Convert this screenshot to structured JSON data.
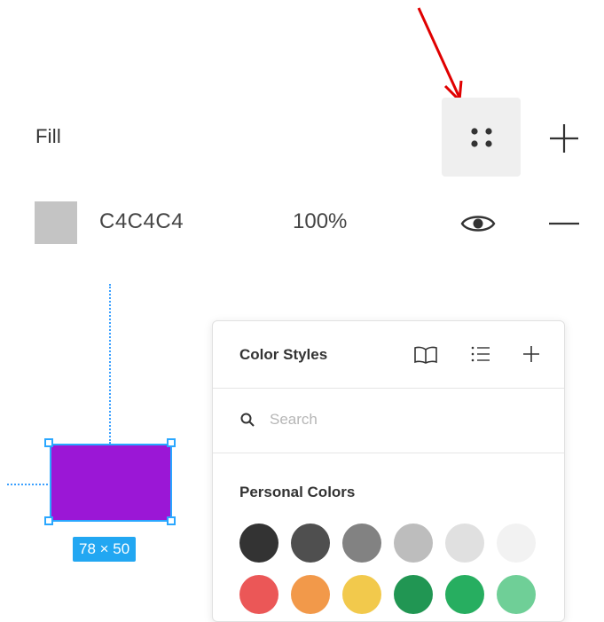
{
  "fill": {
    "label": "Fill",
    "styles_button_icon": "four-dots-icon",
    "add_icon": "plus-icon"
  },
  "layer": {
    "swatch_color": "#C4C4C4",
    "hex": "C4C4C4",
    "opacity": "100%",
    "visibility_icon": "eye-icon",
    "remove_icon": "minus-icon"
  },
  "canvas": {
    "rect_color": "#9B17D6",
    "dimension_label": "78 × 50"
  },
  "popover": {
    "title": "Color Styles",
    "icons": [
      "book-icon",
      "list-icon",
      "plus-icon"
    ],
    "search_placeholder": "Search",
    "section_title": "Personal Colors",
    "colors": [
      [
        "#333333",
        "#4f4f4f",
        "#828282",
        "#bdbdbd",
        "#e0e0e0",
        "#f2f2f2"
      ],
      [
        "#eb5757",
        "#f2994a",
        "#f2c94c",
        "#219653",
        "#27ae60",
        "#6fcf97"
      ]
    ]
  },
  "annotation": {
    "arrow_color": "#e00000"
  }
}
